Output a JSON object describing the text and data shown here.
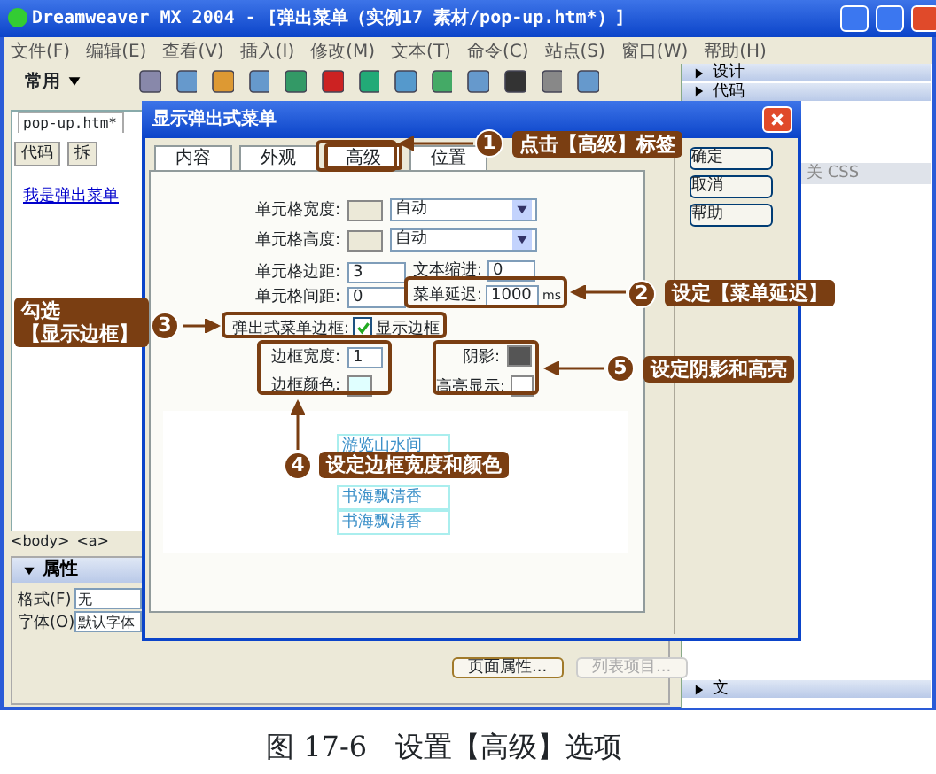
{
  "window": {
    "title": "Dreamweaver MX 2004 - [弹出菜单（实例17  素材/pop-up.htm*）]"
  },
  "menu": [
    "文件(F)",
    "编辑(E)",
    "查看(V)",
    "插入(I)",
    "修改(M)",
    "文本(T)",
    "命令(C)",
    "站点(S)",
    "窗口(W)",
    "帮助(H)"
  ],
  "toolbar": {
    "category": "常用"
  },
  "right_panels": [
    {
      "label": "设计",
      "kind": "header"
    },
    {
      "label": "代码",
      "kind": "header"
    },
    {
      "label": "关 CSS",
      "kind": "tab"
    },
    {
      "label": "文",
      "kind": "header"
    }
  ],
  "document": {
    "tab": "pop-up.htm*",
    "view_buttons": [
      "代码",
      "拆"
    ],
    "link": "我是弹出菜单",
    "tag_bar": [
      "<body>",
      "<a>"
    ]
  },
  "properties": {
    "title": "属性",
    "fields": [
      {
        "label": "格式(F)",
        "value": "无"
      },
      {
        "label": "字体(O)",
        "value": "默认字体"
      }
    ],
    "buttons": [
      {
        "label": "页面属性...",
        "disabled": false
      },
      {
        "label": "列表项目...",
        "disabled": true
      }
    ]
  },
  "dialog": {
    "title": "显示弹出式菜单",
    "tabs": [
      {
        "label": "内容",
        "selected": false
      },
      {
        "label": "外观",
        "selected": false
      },
      {
        "label": "高级",
        "selected": true
      },
      {
        "label": "位置",
        "selected": false
      }
    ],
    "buttons": [
      "确定",
      "取消",
      "帮助"
    ],
    "cell_sizes": [
      {
        "label": "单元格宽度:",
        "color": "#ece9d8",
        "value": "自动"
      },
      {
        "label": "单元格高度:",
        "color": "#ece9d8",
        "value": "自动"
      }
    ],
    "cell_padding": {
      "label": "单元格边距:",
      "value": "3"
    },
    "text_indent": {
      "label": "文本缩进:",
      "value": "0"
    },
    "cell_spacing": {
      "label": "单元格间距:",
      "value": "0"
    },
    "menu_delay": {
      "label": "菜单延迟:",
      "value": "1000",
      "unit": "ms"
    },
    "border": {
      "label": "弹出式菜单边框:",
      "checkbox": "显示边框",
      "checked": true
    },
    "border_width": {
      "label": "边框宽度:",
      "value": "1"
    },
    "border_color": {
      "label": "边框颜色:",
      "color": "#e0ffff"
    },
    "shadow": {
      "label": "阴影:",
      "color": "#555555"
    },
    "highlight": {
      "label": "高亮显示:",
      "color": "#ffffff"
    },
    "preview_items": [
      "游览山水间",
      "书海飘清香",
      "书海飘清香"
    ]
  },
  "annotations": [
    {
      "number": "1",
      "text": "点击【高级】标签"
    },
    {
      "number": "2",
      "text": "设定【菜单延迟】"
    },
    {
      "number": "3",
      "text": "勾选【显示边框】"
    },
    {
      "number": "4",
      "text": "设定边框宽度和颜色"
    },
    {
      "number": "5",
      "text": "设定阴影和高亮"
    }
  ],
  "caption": "图 17-6　设置【高级】选项"
}
